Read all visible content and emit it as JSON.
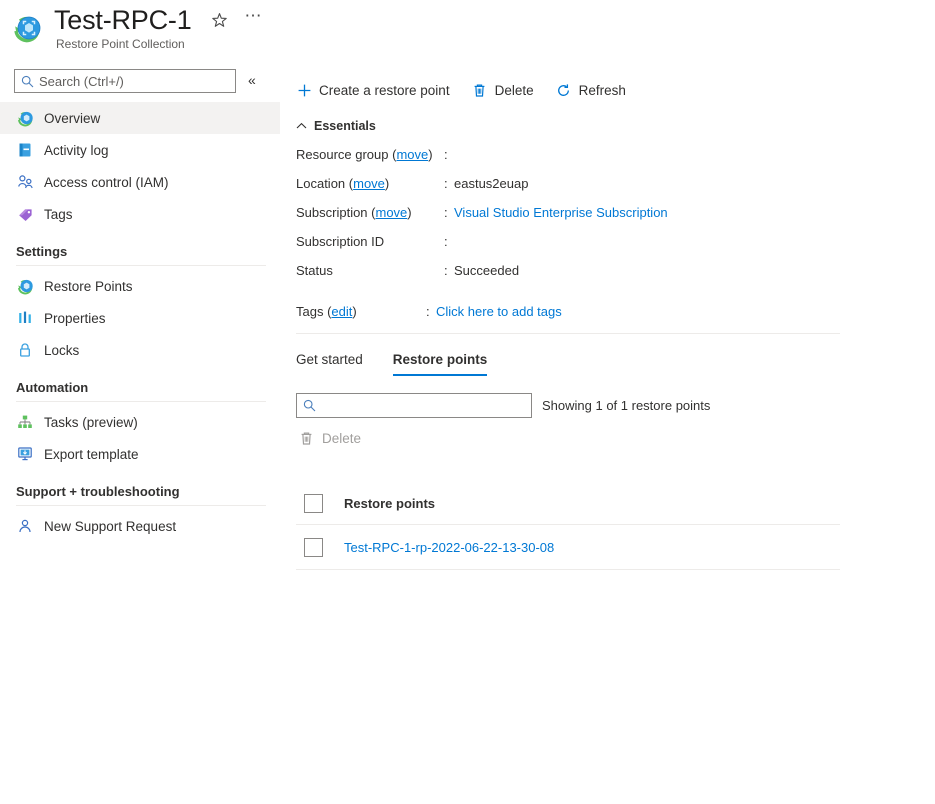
{
  "header": {
    "title": "Test-RPC-1",
    "subtitle": "Restore Point Collection",
    "resource_icon": "restore-point-collection-icon",
    "favorite_icon": "star-icon",
    "more_icon": "ellipsis-icon"
  },
  "sidebar": {
    "search": {
      "placeholder": "Search (Ctrl+/)",
      "value": "",
      "icon": "search-icon"
    },
    "collapse_label": "«",
    "items": [
      {
        "label": "Overview",
        "icon": "overview-icon",
        "selected": true
      },
      {
        "label": "Activity log",
        "icon": "activity-log-icon",
        "selected": false
      },
      {
        "label": "Access control (IAM)",
        "icon": "access-control-icon",
        "selected": false
      },
      {
        "label": "Tags",
        "icon": "tag-icon",
        "selected": false
      }
    ],
    "groups": [
      {
        "title": "Settings",
        "items": [
          {
            "label": "Restore Points",
            "icon": "restore-points-icon"
          },
          {
            "label": "Properties",
            "icon": "properties-icon"
          },
          {
            "label": "Locks",
            "icon": "lock-icon"
          }
        ]
      },
      {
        "title": "Automation",
        "items": [
          {
            "label": "Tasks (preview)",
            "icon": "tasks-icon"
          },
          {
            "label": "Export template",
            "icon": "export-template-icon"
          }
        ]
      },
      {
        "title": "Support + troubleshooting",
        "items": [
          {
            "label": "New Support Request",
            "icon": "support-request-icon"
          }
        ]
      }
    ]
  },
  "commandbar": {
    "create_label": "Create a restore point",
    "create_icon": "plus-icon",
    "delete_label": "Delete",
    "delete_icon": "trash-icon",
    "refresh_label": "Refresh",
    "refresh_icon": "refresh-icon"
  },
  "essentials": {
    "title": "Essentials",
    "collapse_icon": "chevron-up-icon",
    "rows": [
      {
        "label": "Resource group",
        "link": "move",
        "colon": ":",
        "value": "",
        "value_is_link": false
      },
      {
        "label": "Location",
        "link": "move",
        "colon": ":",
        "value": "eastus2euap",
        "value_is_link": false
      },
      {
        "label": "Subscription",
        "link": "move",
        "colon": ":",
        "value": "Visual Studio Enterprise Subscription",
        "value_is_link": true
      },
      {
        "label": "Subscription ID",
        "link": "",
        "colon": ":",
        "value": "",
        "value_is_link": false
      },
      {
        "label": "Status",
        "link": "",
        "colon": ":",
        "value": "Succeeded",
        "value_is_link": false
      }
    ],
    "tags_row": {
      "label": "Tags",
      "link": "edit",
      "colon": ":",
      "value": "Click here to add tags",
      "value_is_link": true
    }
  },
  "tabs": [
    {
      "label": "Get started",
      "active": false
    },
    {
      "label": "Restore points",
      "active": true
    }
  ],
  "filter": {
    "placeholder": "",
    "value": "",
    "icon": "search-icon",
    "showing_text": "Showing 1 of 1 restore points"
  },
  "table_commandbar": {
    "delete_label": "Delete",
    "delete_icon": "trash-icon",
    "disabled": true
  },
  "grid": {
    "header_checkbox": "select-all-checkbox",
    "columns": [
      "Restore points"
    ],
    "rows": [
      {
        "name": "Test-RPC-1-rp-2022-06-22-13-30-08",
        "checked": false
      }
    ]
  },
  "colors": {
    "accent": "#0078d4",
    "text": "#323130",
    "muted": "#605e5c",
    "disabled": "#a19f9d",
    "selected_bg": "#f3f2f1",
    "divider": "#edebe9"
  }
}
